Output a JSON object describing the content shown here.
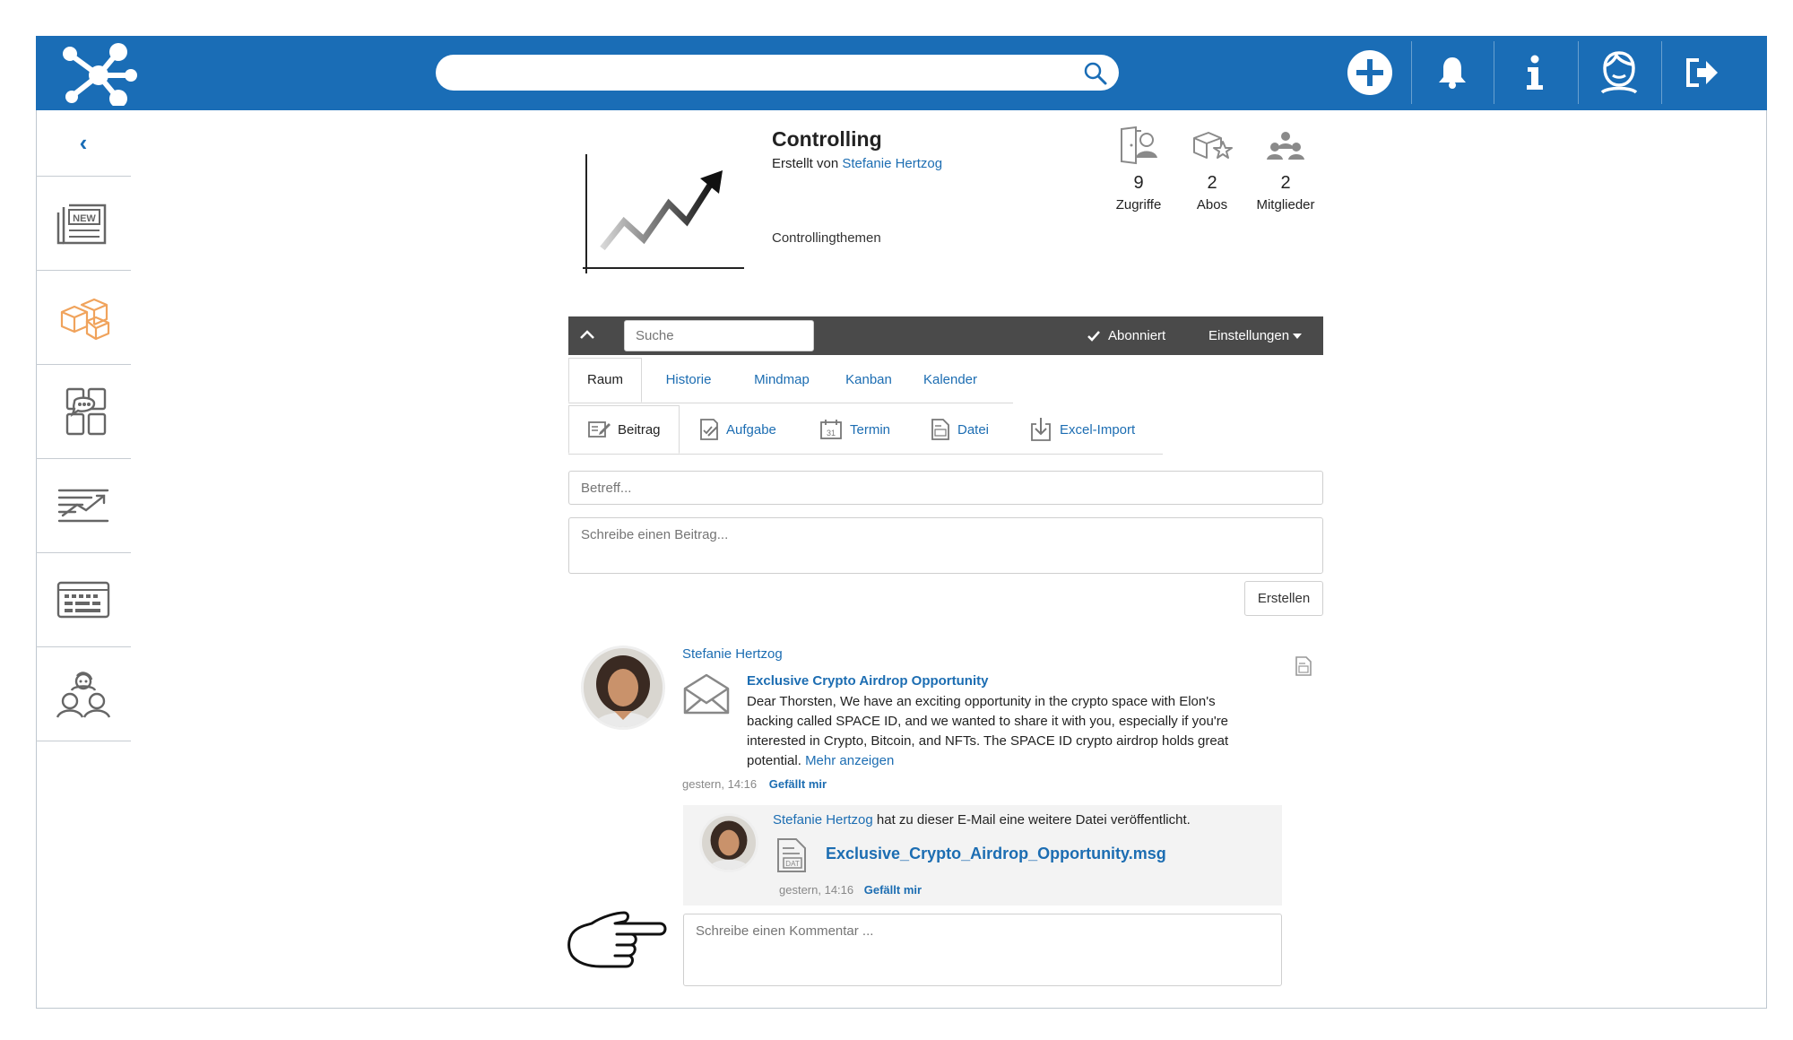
{
  "header": {
    "search_placeholder": "",
    "icons": [
      "network-logo-icon",
      "search-icon",
      "plus-icon",
      "bell-icon",
      "info-icon",
      "user-profile-icon",
      "logout-icon"
    ]
  },
  "sidebar": {
    "collapse_glyph": "‹",
    "items": [
      {
        "name": "news-icon",
        "badge": "NEW"
      },
      {
        "name": "rooms-icon"
      },
      {
        "name": "chat-icon"
      },
      {
        "name": "analytics-icon"
      },
      {
        "name": "keyboard-icon"
      },
      {
        "name": "community-icon"
      }
    ],
    "active_color": "#f0a35c"
  },
  "room": {
    "title": "Controlling",
    "created_by_label": "Erstellt von",
    "creator": "Stefanie Hertzog",
    "description": "Controllingthemen",
    "stats": [
      {
        "value": "9",
        "label": "Zugriffe"
      },
      {
        "value": "2",
        "label": "Abos"
      },
      {
        "value": "2",
        "label": "Mitglieder"
      }
    ]
  },
  "toolbar": {
    "search_placeholder": "Suche",
    "subscribed_label": "Abonniert",
    "settings_label": "Einstellungen"
  },
  "tabs": [
    "Raum",
    "Historie",
    "Mindmap",
    "Kanban",
    "Kalender"
  ],
  "post_types": [
    "Beitrag",
    "Aufgabe",
    "Termin",
    "Datei",
    "Excel-Import"
  ],
  "composer": {
    "subject_placeholder": "Betreff...",
    "body_placeholder": "Schreibe einen Beitrag...",
    "create_label": "Erstellen"
  },
  "post": {
    "author": "Stefanie Hertzog",
    "subject": "Exclusive Crypto Airdrop Opportunity",
    "body": "Dear Thorsten, We have an exciting opportunity in the crypto space with Elon's backing called SPACE ID, and we wanted to share it with you, especially if you're interested in Crypto, Bitcoin, and NFTs. The SPACE ID crypto airdrop holds great potential.",
    "more_label": "Mehr anzeigen",
    "time": "gestern, 14:16",
    "like_label": "Gefällt mir"
  },
  "attachment": {
    "author": "Stefanie Hertzog",
    "action_text": "hat zu dieser E-Mail eine weitere Datei veröffentlicht.",
    "filename": "Exclusive_Crypto_Airdrop_Opportunity.msg",
    "file_type": "DAT",
    "time": "gestern, 14:16",
    "like_label": "Gefällt mir"
  },
  "comment": {
    "placeholder": "Schreibe einen Kommentar ..."
  },
  "colors": {
    "brand_blue": "#1a6db6",
    "link_blue": "#1c6db2",
    "toolbar_dark": "#4a4a4a",
    "sidebar_active": "#f0a35c"
  }
}
